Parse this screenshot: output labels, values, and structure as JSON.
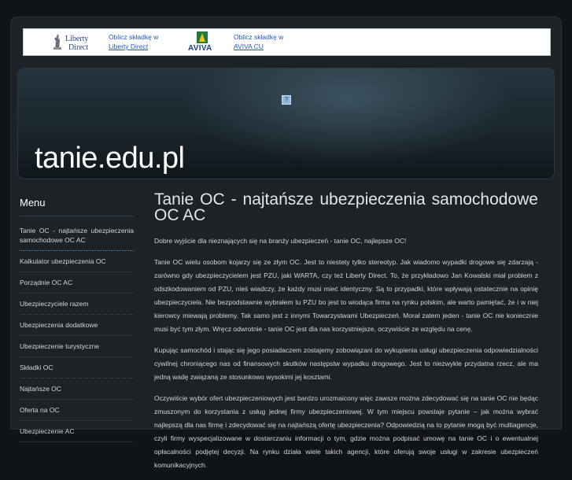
{
  "ads": [
    {
      "brand": "Liberty Direct",
      "logo_line1": "Liberty",
      "logo_line2": "Direct",
      "link_line1": "Oblicz składkę w",
      "link_line2": "Liberty Direct"
    },
    {
      "brand": "AVIVA",
      "logo_word": "AVIVA",
      "link_line1": "Oblicz składkę w",
      "link_line2": "AVIVA CU"
    }
  ],
  "banner": {
    "title": "tanie.edu.pl"
  },
  "sidebar": {
    "heading": "Menu",
    "items": [
      {
        "label": "Tanie OC - najtańsze ubezpieczenia samochodowe OC AC"
      },
      {
        "label": "Kalkulator ubezpieczenia OC"
      },
      {
        "label": "Porządnie OC AC"
      },
      {
        "label": "Ubezpieczyciele razem"
      },
      {
        "label": "Ubezpieczenia dodatkowe"
      },
      {
        "label": "Ubezpieczenie turystyczne"
      },
      {
        "label": "Składki OC"
      },
      {
        "label": "Najtańsze OC"
      },
      {
        "label": "Oferta na OC"
      },
      {
        "label": "Ubezpieczenie AC"
      }
    ]
  },
  "article": {
    "title": "Tanie OC - najtańsze ubezpieczenia samochodowe OC AC",
    "paragraphs": [
      "Dobre wyjście dla nieznających się na branży ubezpieczeń - tanie OC, najlepsze OC!",
      "Tanie OC wielu osobom kojarzy się ze złym OC. Jest to niestety tylko stereotyp. Jak wiadomo wypadki drogowe się zdarzają - zarówno gdy ubezpieczycielem jest PZU, jaki WARTA, czy też Liberty Direct. To, że przykładowo Jan Kowalski miał problem z odszkodowaniem od PZU, nieś wiadczy, że każdy musi mieć identyczny. Są to przypadki, które wpływają ostatecznie na opinię ubezpieczyciela. Nie bezpodstawnie wybrałem tu PZU bo jest to wiodąca firma na rynku polskim, ale warto pamiętać, że i w niej kierowcy miewają problemy. Tak samo jest z innymi Towarzystwami Ubezpieczeń. Morał zatem jeden - tanie OC nie koniecznie musi być tym złym. Wręcz odwrotnie - tanie OC jest dla nas korzystniejsze, oczywiście ze względu na cenę.",
      "Kupując samochód i stając się jego posiadaczem zostajemy zobowiązani do wykupienia usługi ubezpieczenia odpowiedzialności cywilnej chroniącego nas od finansowych skutków następstw wypadku drogowego. Jest to niezwykle przydatna rzecz, ale ma jedną wadę związaną ze stosunkowo wysokimi jej kosztami.",
      "Oczywiście wybór ofert ubezpieczeniowych jest bardzo urozmaicony więc zawsze można zdecydować się na tanie OC nie będąc zmuszonym do korzystania z usług jednej firmy ubezpieczeniowej. W tym miejscu powstaje pytanie – jak można wybrać najlepszą dla nas firmę i zdecydować się na najtańszą ofertę ubezpieczenia? Odpowiedzią na to pytanie mogą być multiagencje, czyli firmy wyspecjalizowane w dostarczaniu informacji o tym, gdzie można podpisać umowę na tanie OC i o ewentualnej opłacalności podjętej decyzji. Na rynku działa wiele takich agencji, które oferują swoje usługi w zakresie ubezpieczeń komunikacyjnych."
    ]
  },
  "colors": {
    "background": "#111417",
    "link": "#2457c5",
    "text": "#d3d6d8"
  }
}
